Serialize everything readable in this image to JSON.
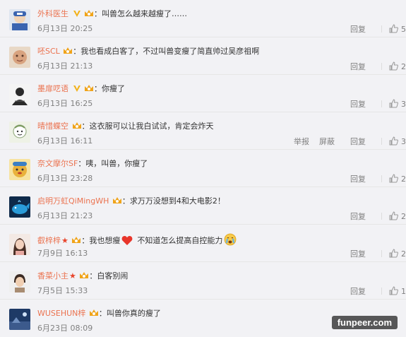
{
  "separator": "：",
  "reply_label": "回复",
  "report_label": "举报",
  "block_label": "屏蔽",
  "comments": [
    {
      "user": "外科医生",
      "text": "叫兽怎么越来越瘦了……",
      "date": "6月13日 20:25",
      "likes": "5",
      "avatar_color": "#3a64b0"
    },
    {
      "user": "呸SCL",
      "text": "我也看成白客了，不过叫兽变瘦了简直帅过吴彦祖啊",
      "date": "6月13日 21:13",
      "likes": "2",
      "avatar_color": "#c98a66"
    },
    {
      "user": "墨扉呓语",
      "text": "你瘦了",
      "date": "6月13日 16:25",
      "likes": "3",
      "avatar_color": "#2a2a2a"
    },
    {
      "user": "晴惜蝶空",
      "text": "这衣服可以让我白试试，肯定会炸天",
      "date": "6月13日 16:11",
      "likes": "3",
      "avatar_color": "#9ab087"
    },
    {
      "user": "奈文摩尔SF",
      "text": "咦，叫兽，你瘦了",
      "date": "6月13日 23:28",
      "likes": "2",
      "avatar_color": "#e9b13b"
    },
    {
      "user": "启明万虹QiMingWH",
      "text": "求万万没想到4和大电影2！",
      "date": "6月13日 21:23",
      "likes": "2",
      "avatar_color": "#2a77b8"
    },
    {
      "user": "叡梓梓",
      "text_a": "我也想瘦",
      "text_b": "不知道怎么提高自控能力",
      "date": "7月9日 16:13",
      "likes": "2",
      "avatar_color": "#c9a89a"
    },
    {
      "user": "香菜小主",
      "text": "白客别闹",
      "date": "7月5日 15:33",
      "likes": "1",
      "avatar_color": "#a88c72"
    },
    {
      "user": "WUSEHUN梓",
      "text": "叫兽你真的瘦了",
      "date": "6月23日 08:09",
      "likes": "",
      "avatar_color": "#3c5a8c"
    }
  ],
  "watermark": "funpeer.com"
}
